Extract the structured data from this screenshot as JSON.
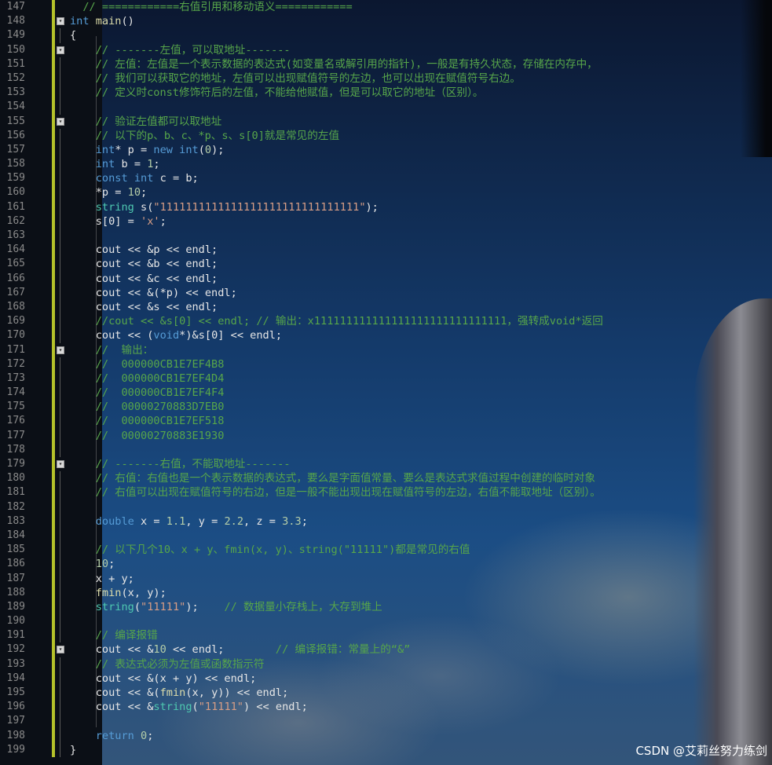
{
  "lines": [
    {
      "n": "147",
      "parts": [
        [
          "cm",
          "  // ============右值引用和移动语义============"
        ]
      ]
    },
    {
      "n": "148",
      "fold": "-",
      "parts": [
        [
          "kw",
          "int"
        ],
        [
          "vr",
          " "
        ],
        [
          "fn",
          "main"
        ],
        [
          "vr",
          "()"
        ]
      ]
    },
    {
      "n": "149",
      "parts": [
        [
          "vr",
          "{"
        ]
      ]
    },
    {
      "n": "150",
      "fold": "-",
      "parts": [
        [
          "cm",
          "    // -------左值，可以取地址-------"
        ]
      ]
    },
    {
      "n": "151",
      "parts": [
        [
          "cm",
          "    // 左值：左值是一个表示数据的表达式(如变量名或解引用的指针)，一般是有持久状态，存储在内存中，"
        ]
      ]
    },
    {
      "n": "152",
      "parts": [
        [
          "cm",
          "    // 我们可以获取它的地址，左值可以出现赋值符号的左边，也可以出现在赋值符号右边。"
        ]
      ]
    },
    {
      "n": "153",
      "parts": [
        [
          "cm",
          "    // 定义时const修饰符后的左值，不能给他赋值，但是可以取它的地址（区别）。"
        ]
      ]
    },
    {
      "n": "154",
      "parts": []
    },
    {
      "n": "155",
      "fold": "-",
      "parts": [
        [
          "cm",
          "    // 验证左值都可以取地址"
        ]
      ]
    },
    {
      "n": "156",
      "parts": [
        [
          "cm",
          "    // 以下的p、b、c、*p、s、s[0]就是常见的左值"
        ]
      ]
    },
    {
      "n": "157",
      "parts": [
        [
          "vr",
          "    "
        ],
        [
          "kw",
          "int"
        ],
        [
          "vr",
          "* p = "
        ],
        [
          "kw",
          "new"
        ],
        [
          "vr",
          " "
        ],
        [
          "kw",
          "int"
        ],
        [
          "vr",
          "("
        ],
        [
          "nm",
          "0"
        ],
        [
          "vr",
          ");"
        ]
      ]
    },
    {
      "n": "158",
      "parts": [
        [
          "vr",
          "    "
        ],
        [
          "kw",
          "int"
        ],
        [
          "vr",
          " b = "
        ],
        [
          "nm",
          "1"
        ],
        [
          "vr",
          ";"
        ]
      ]
    },
    {
      "n": "159",
      "parts": [
        [
          "vr",
          "    "
        ],
        [
          "kw",
          "const"
        ],
        [
          "vr",
          " "
        ],
        [
          "kw",
          "int"
        ],
        [
          "vr",
          " c = b;"
        ]
      ]
    },
    {
      "n": "160",
      "parts": [
        [
          "vr",
          "    *p = "
        ],
        [
          "nm",
          "10"
        ],
        [
          "vr",
          ";"
        ]
      ]
    },
    {
      "n": "161",
      "parts": [
        [
          "vr",
          "    "
        ],
        [
          "tp",
          "string"
        ],
        [
          "vr",
          " s("
        ],
        [
          "st",
          "\"1111111111111111111111111111111\""
        ],
        [
          "vr",
          ");"
        ]
      ]
    },
    {
      "n": "162",
      "parts": [
        [
          "vr",
          "    s[0] = "
        ],
        [
          "st",
          "'x'"
        ],
        [
          "vr",
          ";"
        ]
      ]
    },
    {
      "n": "163",
      "parts": []
    },
    {
      "n": "164",
      "parts": [
        [
          "vr",
          "    cout << &p << endl;"
        ]
      ]
    },
    {
      "n": "165",
      "parts": [
        [
          "vr",
          "    cout << &b << endl;"
        ]
      ]
    },
    {
      "n": "166",
      "parts": [
        [
          "vr",
          "    cout << &c << endl;"
        ]
      ]
    },
    {
      "n": "167",
      "parts": [
        [
          "vr",
          "    cout << &(*p) << endl;"
        ]
      ]
    },
    {
      "n": "168",
      "parts": [
        [
          "vr",
          "    cout << &s << endl;"
        ]
      ]
    },
    {
      "n": "169",
      "parts": [
        [
          "cm",
          "    //cout << &s[0] << endl; // 输出：x111111111111111111111111111111，强转成void*返回"
        ]
      ]
    },
    {
      "n": "170",
      "parts": [
        [
          "vr",
          "    cout << ("
        ],
        [
          "kw",
          "void"
        ],
        [
          "vr",
          "*)&s[0] << endl;"
        ]
      ]
    },
    {
      "n": "171",
      "fold": "-",
      "parts": [
        [
          "cm",
          "    //  输出："
        ]
      ]
    },
    {
      "n": "172",
      "parts": [
        [
          "cm",
          "    //  000000CB1E7EF4B8"
        ]
      ]
    },
    {
      "n": "173",
      "parts": [
        [
          "cm",
          "    //  000000CB1E7EF4D4"
        ]
      ]
    },
    {
      "n": "174",
      "parts": [
        [
          "cm",
          "    //  000000CB1E7EF4F4"
        ]
      ]
    },
    {
      "n": "175",
      "parts": [
        [
          "cm",
          "    //  00000270883D7EB0"
        ]
      ]
    },
    {
      "n": "176",
      "parts": [
        [
          "cm",
          "    //  000000CB1E7EF518"
        ]
      ]
    },
    {
      "n": "177",
      "parts": [
        [
          "cm",
          "    //  00000270883E1930"
        ]
      ]
    },
    {
      "n": "178",
      "parts": []
    },
    {
      "n": "179",
      "fold": "-",
      "parts": [
        [
          "cm",
          "    // -------右值，不能取地址-------"
        ]
      ]
    },
    {
      "n": "180",
      "parts": [
        [
          "cm",
          "    // 右值：右值也是一个表示数据的表达式，要么是字面值常量、要么是表达式求值过程中创建的临时对象"
        ]
      ]
    },
    {
      "n": "181",
      "parts": [
        [
          "cm",
          "    // 右值可以出现在赋值符号的右边，但是一般不能出现出现在赋值符号的左边，右值不能取地址（区别）。"
        ]
      ]
    },
    {
      "n": "182",
      "parts": []
    },
    {
      "n": "183",
      "parts": [
        [
          "vr",
          "    "
        ],
        [
          "kw",
          "double"
        ],
        [
          "vr",
          " x = "
        ],
        [
          "nm",
          "1.1"
        ],
        [
          "vr",
          ", y = "
        ],
        [
          "nm",
          "2.2"
        ],
        [
          "vr",
          ", z = "
        ],
        [
          "nm",
          "3.3"
        ],
        [
          "vr",
          ";"
        ]
      ]
    },
    {
      "n": "184",
      "parts": []
    },
    {
      "n": "185",
      "parts": [
        [
          "cm",
          "    // 以下几个10、x + y、fmin(x, y)、string(\"11111\")都是常见的右值"
        ]
      ]
    },
    {
      "n": "186",
      "parts": [
        [
          "vr",
          "    "
        ],
        [
          "nm",
          "10"
        ],
        [
          "vr",
          ";"
        ]
      ]
    },
    {
      "n": "187",
      "parts": [
        [
          "vr",
          "    x + y;"
        ]
      ]
    },
    {
      "n": "188",
      "parts": [
        [
          "vr",
          "    "
        ],
        [
          "fn",
          "fmin"
        ],
        [
          "vr",
          "(x, y);"
        ]
      ]
    },
    {
      "n": "189",
      "parts": [
        [
          "vr",
          "    "
        ],
        [
          "tp",
          "string"
        ],
        [
          "vr",
          "("
        ],
        [
          "st",
          "\"11111\""
        ],
        [
          "vr",
          ");    "
        ],
        [
          "cm",
          "// 数据量小存栈上，大存到堆上"
        ]
      ]
    },
    {
      "n": "190",
      "parts": []
    },
    {
      "n": "191",
      "parts": [
        [
          "cm",
          "    // 编译报错"
        ]
      ]
    },
    {
      "n": "192",
      "fold": "-",
      "parts": [
        [
          "vr",
          "    cout << &"
        ],
        [
          "nm",
          "10"
        ],
        [
          "vr",
          " << endl;        "
        ],
        [
          "cm",
          "// 编译报错：常量上的“&”"
        ]
      ]
    },
    {
      "n": "193",
      "parts": [
        [
          "cm",
          "    // 表达式必须为左值或函数指示符"
        ]
      ]
    },
    {
      "n": "194",
      "parts": [
        [
          "vr",
          "    cout << &(x + y) << endl;"
        ]
      ]
    },
    {
      "n": "195",
      "parts": [
        [
          "vr",
          "    cout << &("
        ],
        [
          "fn",
          "fmin"
        ],
        [
          "vr",
          "(x, y)) << endl;"
        ]
      ]
    },
    {
      "n": "196",
      "parts": [
        [
          "vr",
          "    cout << &"
        ],
        [
          "tp",
          "string"
        ],
        [
          "vr",
          "("
        ],
        [
          "st",
          "\"11111\""
        ],
        [
          "vr",
          ") << endl;"
        ]
      ]
    },
    {
      "n": "197",
      "parts": []
    },
    {
      "n": "198",
      "parts": [
        [
          "vr",
          "    "
        ],
        [
          "kw",
          "return"
        ],
        [
          "vr",
          " "
        ],
        [
          "nm",
          "0"
        ],
        [
          "vr",
          ";"
        ]
      ]
    },
    {
      "n": "199",
      "parts": [
        [
          "vr",
          "}"
        ]
      ]
    }
  ],
  "watermark": "CSDN @艾莉丝努力练剑",
  "colors": {
    "keyword": "#569cd6",
    "comment": "#57a64a",
    "string": "#d69d85",
    "number": "#b5cea8",
    "function": "#dcdcaa",
    "type": "#4ec9b0",
    "line_number": "#8a8a8a",
    "change_marker": "#b5c22a"
  }
}
